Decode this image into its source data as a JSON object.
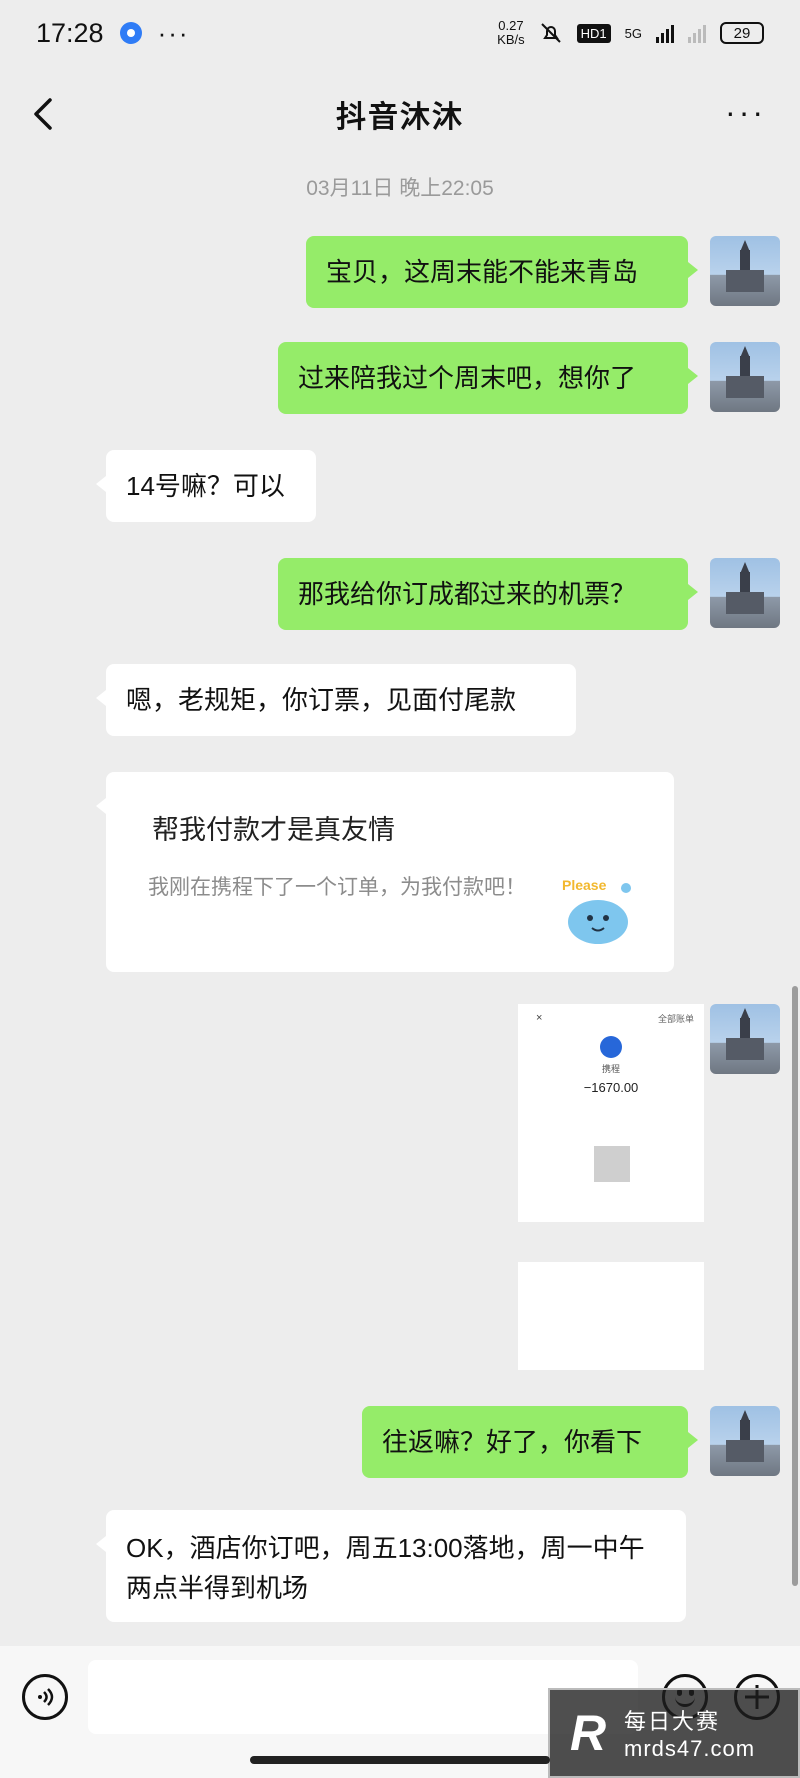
{
  "status_bar": {
    "time": "17:28",
    "more": "···",
    "net_speed_value": "0.27",
    "net_speed_unit": "KB/s",
    "hd_label": "HD1",
    "network_label": "5G",
    "battery": "29"
  },
  "header": {
    "title": "抖音沐沐",
    "more": "···"
  },
  "timestamp": "03月11日 晚上22:05",
  "messages": [
    {
      "side": "out",
      "text": "宝贝，这周末能不能来青岛"
    },
    {
      "side": "out",
      "text": "过来陪我过个周末吧，想你了"
    },
    {
      "side": "in",
      "text": "14号嘛？可以"
    },
    {
      "side": "out",
      "text": "那我给你订成都过来的机票？"
    },
    {
      "side": "in",
      "text": "嗯，老规矩，你订票，见面付尾款"
    },
    {
      "side": "out",
      "text": "往返嘛？好了，你看下"
    },
    {
      "side": "in",
      "text": "OK，酒店你订吧，周五13:00落地，周一中午两点半得到机场"
    }
  ],
  "card": {
    "title": "帮我付款才是真友情",
    "description": "我刚在携程下了一个订单，为我付款吧！",
    "sticker_text": "Please"
  },
  "receipt": {
    "close": "×",
    "top_link": "全部账单",
    "merchant": "携程",
    "amount": "−1670.00"
  },
  "input_bar": {
    "placeholder": ""
  },
  "watermark": {
    "logo": "R",
    "name": "每日大赛",
    "url": "mrds47.com"
  },
  "colors": {
    "outgoing_bubble": "#95ec69",
    "incoming_bubble": "#ffffff",
    "background": "#ededed"
  }
}
